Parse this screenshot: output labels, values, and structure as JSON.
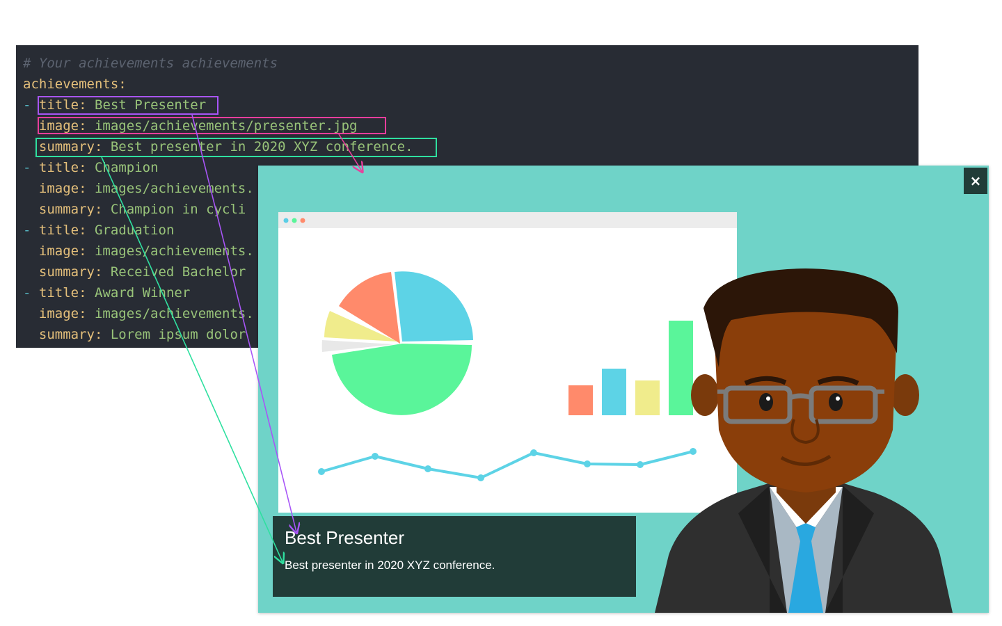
{
  "code": {
    "comment": "# Your achievements achievements",
    "root_key": "achievements:",
    "items": [
      {
        "title_key": "title:",
        "title": "Best Presenter",
        "image_key": "image:",
        "image": "images/achievements/presenter.jpg",
        "summary_key": "summary:",
        "summary": "Best presenter in 2020 XYZ conference."
      },
      {
        "title_key": "title:",
        "title": "Champion",
        "image_key": "image:",
        "image": "images/achievements.",
        "summary_key": "summary:",
        "summary": "Champion in cycli"
      },
      {
        "title_key": "title:",
        "title": "Graduation",
        "image_key": "image:",
        "image": "images/achievements.",
        "summary_key": "summary:",
        "summary": "Received Bachelor"
      },
      {
        "title_key": "title:",
        "title": "Award Winner",
        "image_key": "image:",
        "image": "images/achievements.",
        "summary_key": "summary:",
        "summary": "Lorem ipsum dolor"
      }
    ],
    "dash": "-"
  },
  "modal": {
    "close_icon": "×",
    "title": "Best Presenter",
    "summary": "Best presenter in 2020 XYZ conference."
  },
  "colors": {
    "code_bg": "#282c34",
    "modal_bg": "#6fd3c8",
    "caption_bg": "#213c38",
    "highlight_title": "#a855f7",
    "highlight_image": "#e83e9c",
    "highlight_summary": "#2fe0a0"
  },
  "icons": {
    "close": "close-icon"
  }
}
